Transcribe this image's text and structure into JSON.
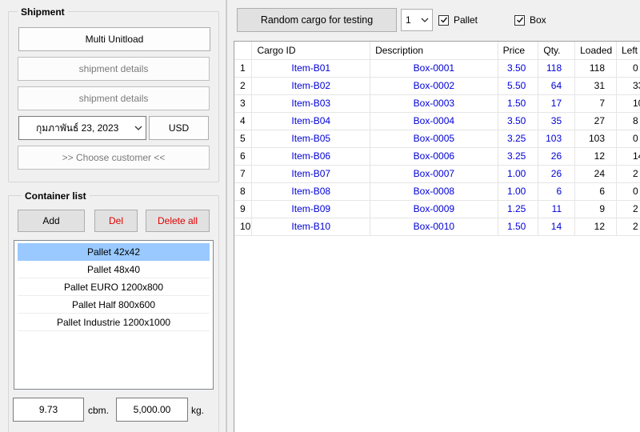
{
  "shipment": {
    "title": "Shipment",
    "multi_unitload_label": "Multi Unitload",
    "details_1": "shipment details",
    "details_2": "shipment details",
    "date_value": "กุมภาพันธ์ 23, 2023",
    "currency": "USD",
    "choose_customer": ">> Choose customer <<"
  },
  "containers": {
    "title": "Container list",
    "add_label": "Add",
    "del_label": "Del",
    "delete_all_label": "Delete all",
    "items": [
      {
        "label": "Pallet 42x42"
      },
      {
        "label": "Pallet 48x40"
      },
      {
        "label": "Pallet EURO 1200x800"
      },
      {
        "label": "Pallet Half 800x600"
      },
      {
        "label": "Pallet Industrie 1200x1000"
      }
    ],
    "selected_index": 0,
    "volume_value": "9.73",
    "volume_unit": "cbm.",
    "weight_value": "5,000.00",
    "weight_unit": "kg."
  },
  "toolbar": {
    "random_cargo_label": "Random cargo for testing",
    "count_value": "1",
    "pallet_label": "Pallet",
    "pallet_checked": true,
    "box_label": "Box",
    "box_checked": true
  },
  "grid": {
    "columns": [
      "",
      "Cargo ID",
      "Description",
      "Price",
      "Qty.",
      "Loaded",
      "Left"
    ],
    "rows": [
      [
        "1",
        "Item-B01",
        "Box-0001",
        "3.50",
        "118",
        "118",
        "0"
      ],
      [
        "2",
        "Item-B02",
        "Box-0002",
        "5.50",
        "64",
        "31",
        "33"
      ],
      [
        "3",
        "Item-B03",
        "Box-0003",
        "1.50",
        "17",
        "7",
        "10"
      ],
      [
        "4",
        "Item-B04",
        "Box-0004",
        "3.50",
        "35",
        "27",
        "8"
      ],
      [
        "5",
        "Item-B05",
        "Box-0005",
        "3.25",
        "103",
        "103",
        "0"
      ],
      [
        "6",
        "Item-B06",
        "Box-0006",
        "3.25",
        "26",
        "12",
        "14"
      ],
      [
        "7",
        "Item-B07",
        "Box-0007",
        "1.00",
        "26",
        "24",
        "2"
      ],
      [
        "8",
        "Item-B08",
        "Box-0008",
        "1.00",
        "6",
        "6",
        "0"
      ],
      [
        "9",
        "Item-B09",
        "Box-0009",
        "1.25",
        "11",
        "9",
        "2"
      ],
      [
        "10",
        "Item-B10",
        "Box-0010",
        "1.50",
        "14",
        "12",
        "2"
      ]
    ]
  },
  "colors": {
    "selection": "#99c9ff",
    "link_blue": "#0000d8",
    "danger_red": "#e00000"
  }
}
